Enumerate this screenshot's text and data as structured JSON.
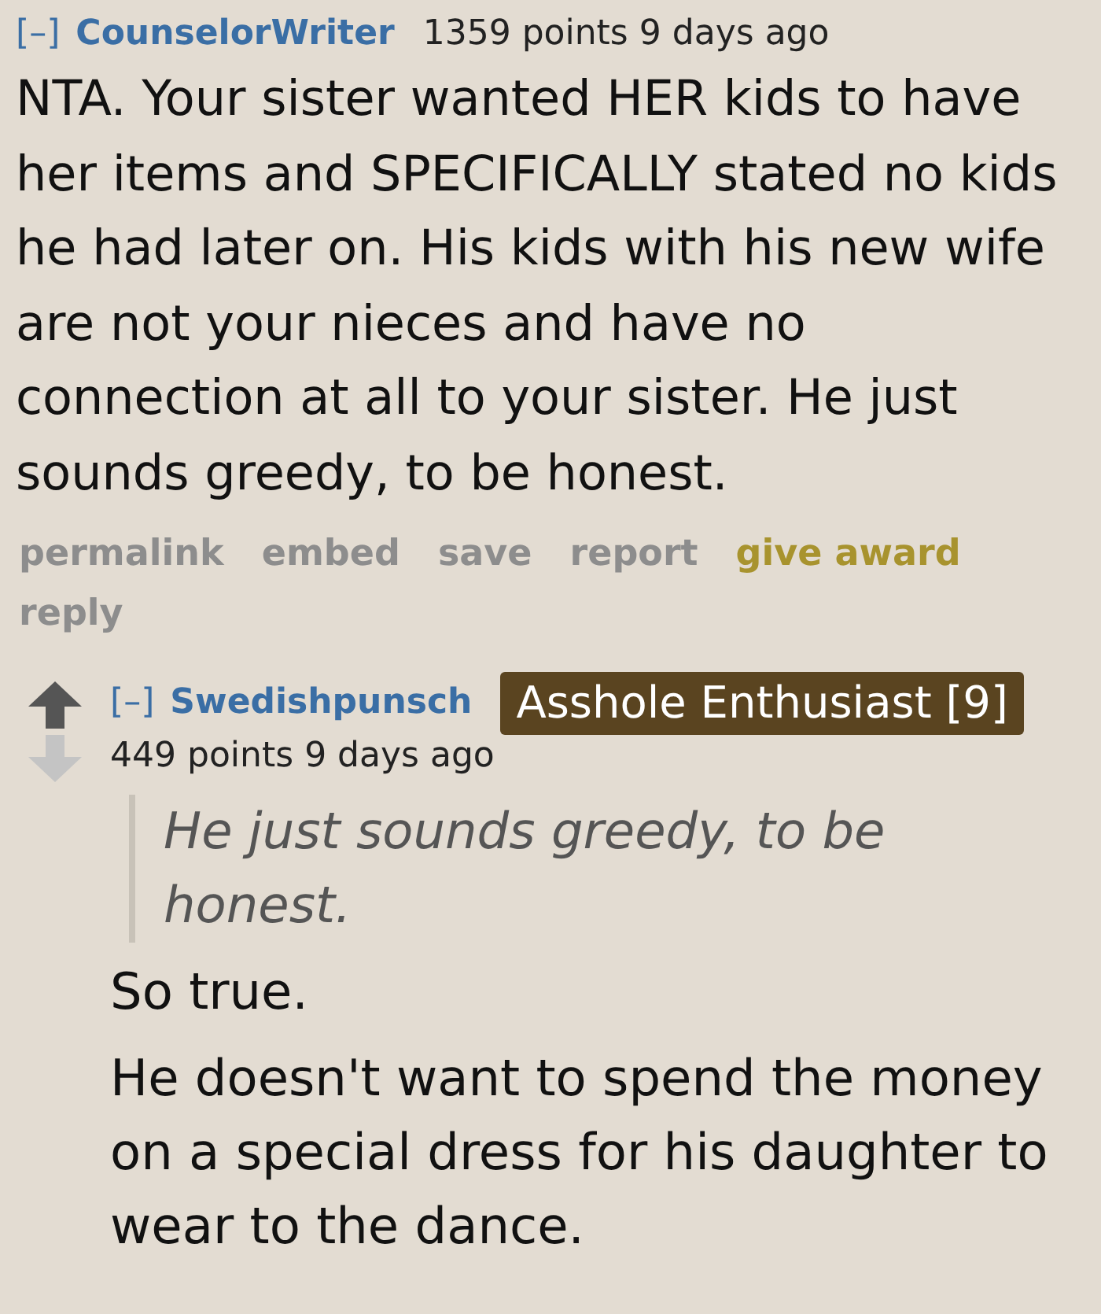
{
  "comments": [
    {
      "toggle": "[–]",
      "author": "CounselorWriter",
      "score": "1359 points",
      "time": "9 days ago",
      "paragraphs": [
        {
          "kind": "text",
          "text": "NTA. Your sister wanted HER kids to have her items and SPECIFICALLY stated no kids he had later on. His kids with his new wife are not your nieces and have no connection at all to your sister. He just sounds greedy, to be honest."
        }
      ],
      "actions": [
        {
          "label": "permalink",
          "kind": "plain"
        },
        {
          "label": "embed",
          "kind": "plain"
        },
        {
          "label": "save",
          "kind": "plain"
        },
        {
          "label": "report",
          "kind": "plain"
        },
        {
          "label": "give award",
          "kind": "award"
        },
        {
          "label": "reply",
          "kind": "plain"
        }
      ],
      "replies": [
        {
          "toggle": "[–]",
          "author": "Swedishpunsch",
          "flair": "Asshole Enthusiast [9]",
          "score": "449 points",
          "time": "9 days ago",
          "paragraphs": [
            {
              "kind": "quote",
              "text": "He just sounds greedy, to be honest."
            },
            {
              "kind": "text",
              "text": "So true."
            },
            {
              "kind": "text",
              "text": "He doesn't want to spend the money on a special dress for his daughter to wear to the dance."
            }
          ]
        }
      ]
    }
  ]
}
